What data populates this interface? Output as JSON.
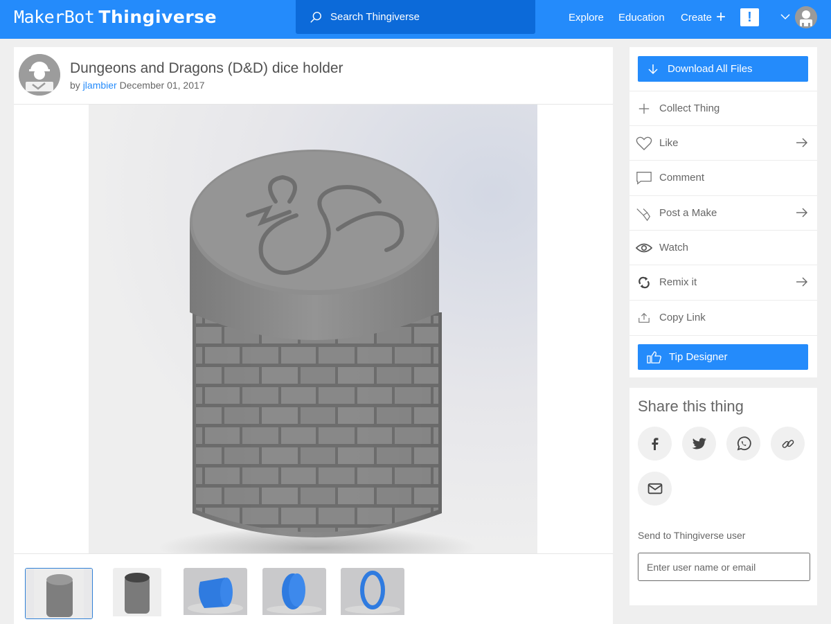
{
  "header": {
    "logo_brand": "MakerBot",
    "logo_product": "Thingiverse",
    "search_placeholder": "Search Thingiverse",
    "nav": [
      "Explore",
      "Education",
      "Create"
    ],
    "create_plus": "+",
    "alert_label": "!",
    "brand_color": "#248bfb"
  },
  "thing": {
    "title": "Dungeons and Dragons (D&D) dice holder",
    "by_prefix": "by",
    "author": "jlambier",
    "date": "December 01, 2017",
    "thumbnails": [
      {
        "label": "gray assembled holder",
        "selected": true
      },
      {
        "label": "gray open holder",
        "selected": false
      },
      {
        "label": "blue body",
        "selected": false
      },
      {
        "label": "blue lid",
        "selected": false
      },
      {
        "label": "blue ring",
        "selected": false
      }
    ]
  },
  "actions": {
    "download": "Download All Files",
    "items": [
      {
        "label": "Collect Thing",
        "icon": "plus-icon",
        "arrow": false
      },
      {
        "label": "Like",
        "icon": "heart-icon",
        "arrow": true
      },
      {
        "label": "Comment",
        "icon": "comment-icon",
        "arrow": false
      },
      {
        "label": "Post a Make",
        "icon": "make-icon",
        "arrow": true
      },
      {
        "label": "Watch",
        "icon": "eye-icon",
        "arrow": false
      },
      {
        "label": "Remix it",
        "icon": "remix-icon",
        "arrow": true
      },
      {
        "label": "Copy Link",
        "icon": "share-upload-icon",
        "arrow": false
      }
    ],
    "tip": "Tip Designer"
  },
  "share": {
    "title": "Share this thing",
    "buttons": [
      "facebook",
      "twitter",
      "whatsapp",
      "link",
      "email"
    ],
    "send_label": "Send to Thingiverse user",
    "send_placeholder": "Enter user name or email"
  }
}
